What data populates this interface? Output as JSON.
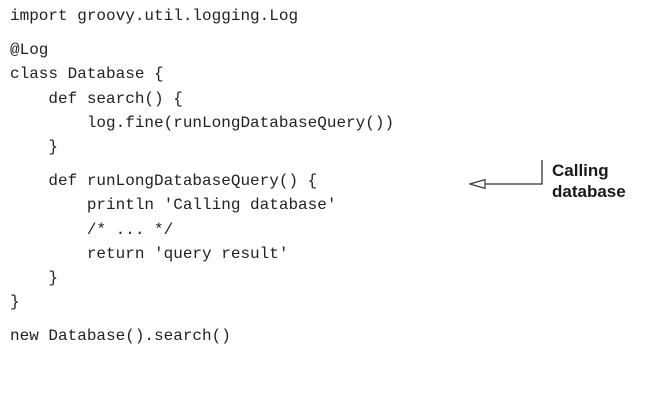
{
  "code": {
    "lines": [
      "import groovy.util.logging.Log",
      "",
      "@Log",
      "class Database {",
      "    def search() {",
      "        log.fine(runLongDatabaseQuery())",
      "    }",
      "",
      "    def runLongDatabaseQuery() {",
      "        println 'Calling database'",
      "        /* ... */",
      "        return 'query result'",
      "    }",
      "}",
      "",
      "new Database().search()"
    ]
  },
  "annotation": {
    "line1": "Calling",
    "line2": "database"
  }
}
